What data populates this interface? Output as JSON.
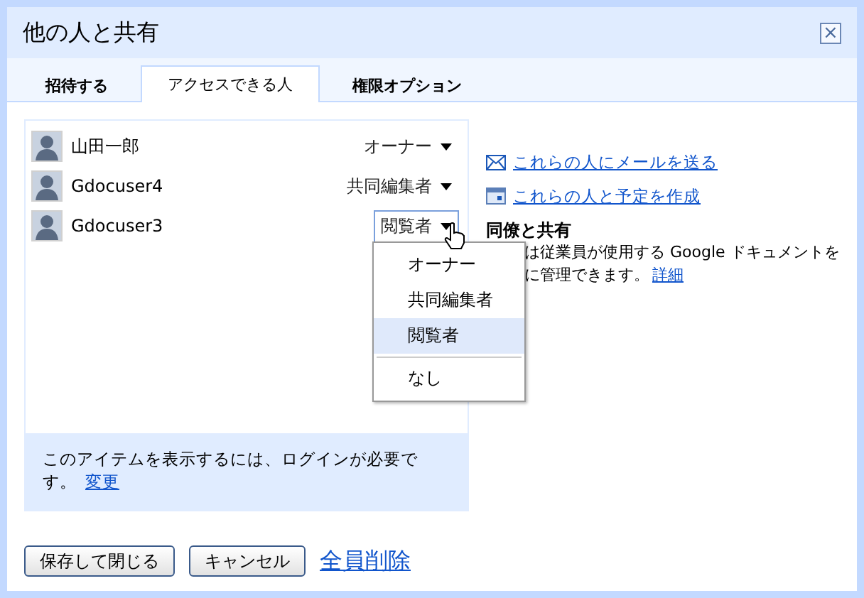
{
  "window": {
    "title": "他の人と共有",
    "close": "×"
  },
  "tabs": [
    {
      "label": "招待する",
      "selected": false
    },
    {
      "label": "アクセスできる人",
      "selected": true
    },
    {
      "label": "権限オプション",
      "selected": false
    }
  ],
  "people": [
    {
      "name": "山田一郎",
      "role": "オーナー",
      "open": false
    },
    {
      "name": "Gdocuser4",
      "role": "共同編集者",
      "open": false
    },
    {
      "name": "Gdocuser3",
      "role": "閲覧者",
      "open": true
    }
  ],
  "role_menu": [
    {
      "label": "オーナー",
      "selected": false
    },
    {
      "label": "共同編集者",
      "selected": false
    },
    {
      "label": "閲覧者",
      "selected": true
    },
    {
      "label": "なし",
      "selected": false,
      "separated": true
    }
  ],
  "note": {
    "text": "このアイテムを表示するには、ログインが必要です。",
    "link": "変更"
  },
  "actions": [
    {
      "label": "これらの人にメールを送る",
      "kind": "mail"
    },
    {
      "label": "これらの人と予定を作成",
      "kind": "calendar"
    }
  ],
  "info": {
    "heading": "同僚と共有",
    "line_1": "は従業員が使用する Google ドキュメントを",
    "line_2": "に管理できます。",
    "link": "詳細"
  },
  "buttons": [
    "保存して閉じる",
    "キャンセル"
  ],
  "remove_all": "全員削除"
}
